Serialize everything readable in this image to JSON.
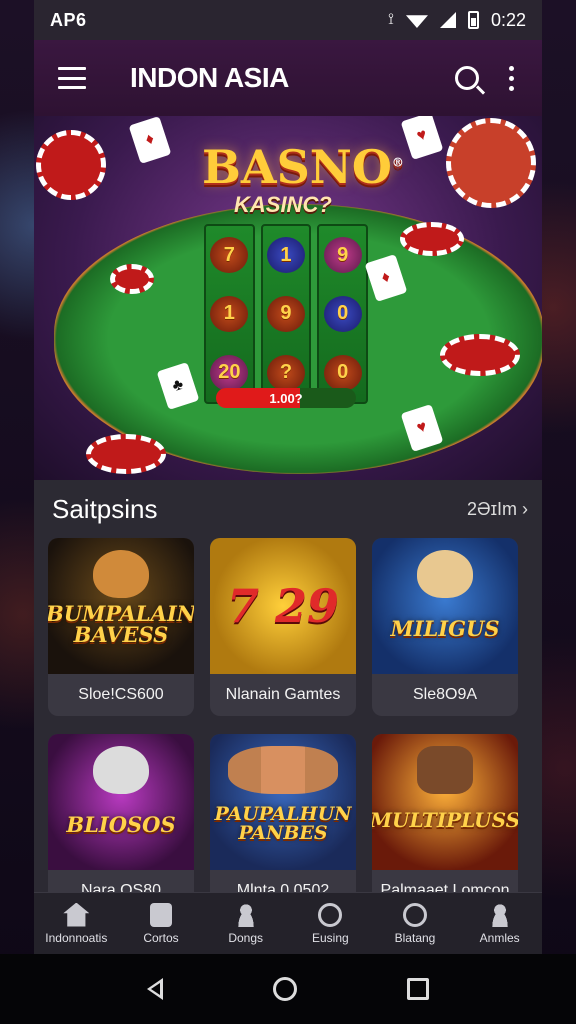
{
  "status_bar": {
    "left_text": "AP6",
    "time": "0:22"
  },
  "app_bar": {
    "title": "INDON ASIA"
  },
  "hero": {
    "brand": "BASNO",
    "brand_mark": "®",
    "sub": "KASINC?",
    "bar_value": "1.00?",
    "reel_symbols": [
      "7",
      "1",
      "20",
      "1",
      "9",
      "?",
      "9",
      "0",
      "0"
    ]
  },
  "section": {
    "title": "Saitpsins",
    "see_all": "2ƏɪIm ›",
    "tiles": [
      {
        "art_label": "BUMPALAIN BAVESS",
        "name": "Sloe!CS600"
      },
      {
        "art_label": "7 29",
        "name": "Nlanain Gamtes"
      },
      {
        "art_label": "MILIGUS",
        "name": "Sle8O9A"
      },
      {
        "art_label": "BLIOSOS",
        "name": "Nara OS80"
      },
      {
        "art_label": "PAUPALHUN PANBES",
        "name": "Mlnta 0.0502"
      },
      {
        "art_label": "MULTIPLUSS",
        "name": "Palmaaet Lomcon"
      }
    ]
  },
  "bottom_nav": [
    {
      "label": "Indonnoatis",
      "icon": "home-icon"
    },
    {
      "label": "Cortos",
      "icon": "dice-icon"
    },
    {
      "label": "Dongs",
      "icon": "person-icon"
    },
    {
      "label": "Eusing",
      "icon": "search-ring-icon"
    },
    {
      "label": "Blatang",
      "icon": "ring-icon"
    },
    {
      "label": "Anmles",
      "icon": "user-icon"
    }
  ]
}
